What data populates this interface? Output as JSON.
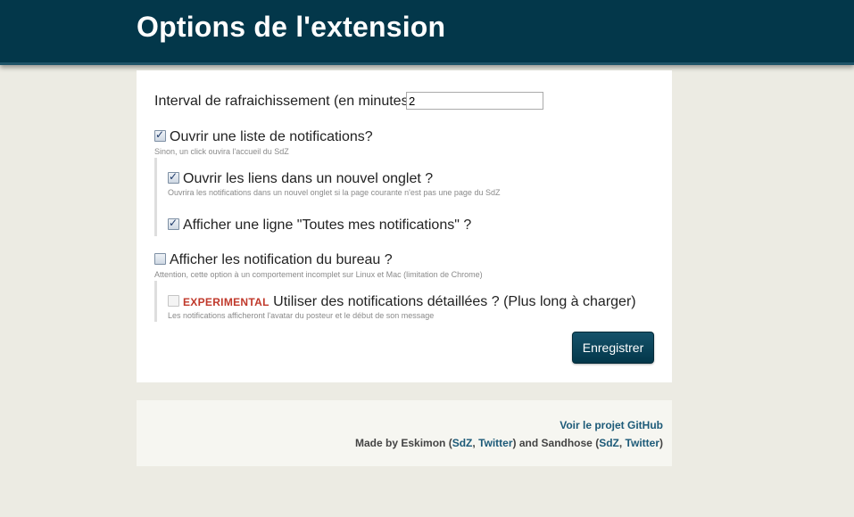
{
  "header": {
    "title": "Options de l'extension"
  },
  "form": {
    "interval_label": "Interval de rafraichissement (en minutes)",
    "interval_value": "2",
    "options": [
      {
        "label": "Ouvrir une liste de notifications?",
        "checked": true,
        "hint": "Sinon, un click ouvira l'accueil du SdZ"
      },
      {
        "label": "Ouvrir les liens dans un nouvel onglet ?",
        "checked": true,
        "hint": "Ouvrira les notifications dans un nouvel onglet si la page courante n'est pas une page du SdZ"
      },
      {
        "label": "Afficher une ligne \"Toutes mes notifications\" ?",
        "checked": true
      },
      {
        "label": "Afficher les notification du bureau ?",
        "checked": false,
        "hint": "Attention, cette option à un comportement incomplet sur Linux et Mac (limitation de Chrome)"
      },
      {
        "badge": "EXPERIMENTAL",
        "label": "Utiliser des notifications détaillées ? (Plus long à charger)",
        "checked": false,
        "disabled": true,
        "hint": "Les notifications afficheront l'avatar du posteur et le début de son message"
      }
    ],
    "save_label": "Enregistrer"
  },
  "footer": {
    "github_link": "Voir le projet GitHub",
    "made_by": "Made by Eskimon (",
    "author1_sdz": "SdZ",
    "sep1": ", ",
    "author1_twitter": "Twitter",
    "and": ") and Sandhose (",
    "author2_sdz": "SdZ",
    "sep2": ", ",
    "author2_twitter": "Twitter",
    "close": ")"
  },
  "colors": {
    "header_bg": "#03374a",
    "page_bg": "#ecebe3",
    "link": "#1c5a78",
    "experimental": "#c0392b"
  }
}
